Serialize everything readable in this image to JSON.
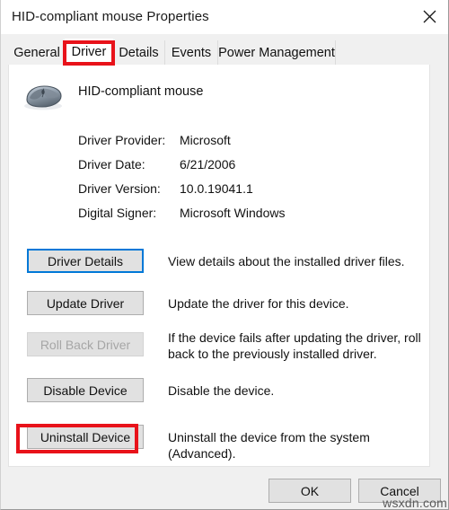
{
  "window": {
    "title": "HID-compliant mouse Properties",
    "close_icon": "close-icon"
  },
  "tabs": [
    {
      "label": "General",
      "active": false
    },
    {
      "label": "Driver",
      "active": true
    },
    {
      "label": "Details",
      "active": false
    },
    {
      "label": "Events",
      "active": false
    },
    {
      "label": "Power Management",
      "active": false
    }
  ],
  "device": {
    "icon": "mouse-icon",
    "name": "HID-compliant mouse"
  },
  "driver_info": [
    {
      "label": "Driver Provider:",
      "value": "Microsoft"
    },
    {
      "label": "Driver Date:",
      "value": "6/21/2006"
    },
    {
      "label": "Driver Version:",
      "value": "10.0.19041.1"
    },
    {
      "label": "Digital Signer:",
      "value": "Microsoft Windows"
    }
  ],
  "actions": [
    {
      "button": "Driver Details",
      "description": "View details about the installed driver files.",
      "state": "focused"
    },
    {
      "button": "Update Driver",
      "description": "Update the driver for this device.",
      "state": "normal"
    },
    {
      "button": "Roll Back Driver",
      "description": "If the device fails after updating the driver, roll back to the previously installed driver.",
      "state": "disabled"
    },
    {
      "button": "Disable Device",
      "description": "Disable the device.",
      "state": "normal"
    },
    {
      "button": "Uninstall Device",
      "description": "Uninstall the device from the system (Advanced).",
      "state": "highlighted"
    }
  ],
  "footer": {
    "ok_label": "OK",
    "cancel_label": "Cancel"
  },
  "watermark": "wsxdn.com",
  "colors": {
    "annotation_red": "#e8121a",
    "focus_blue": "#0078d7",
    "dialog_background": "#f0f0f0",
    "panel_background": "#ffffff",
    "button_face": "#e1e1e1"
  }
}
